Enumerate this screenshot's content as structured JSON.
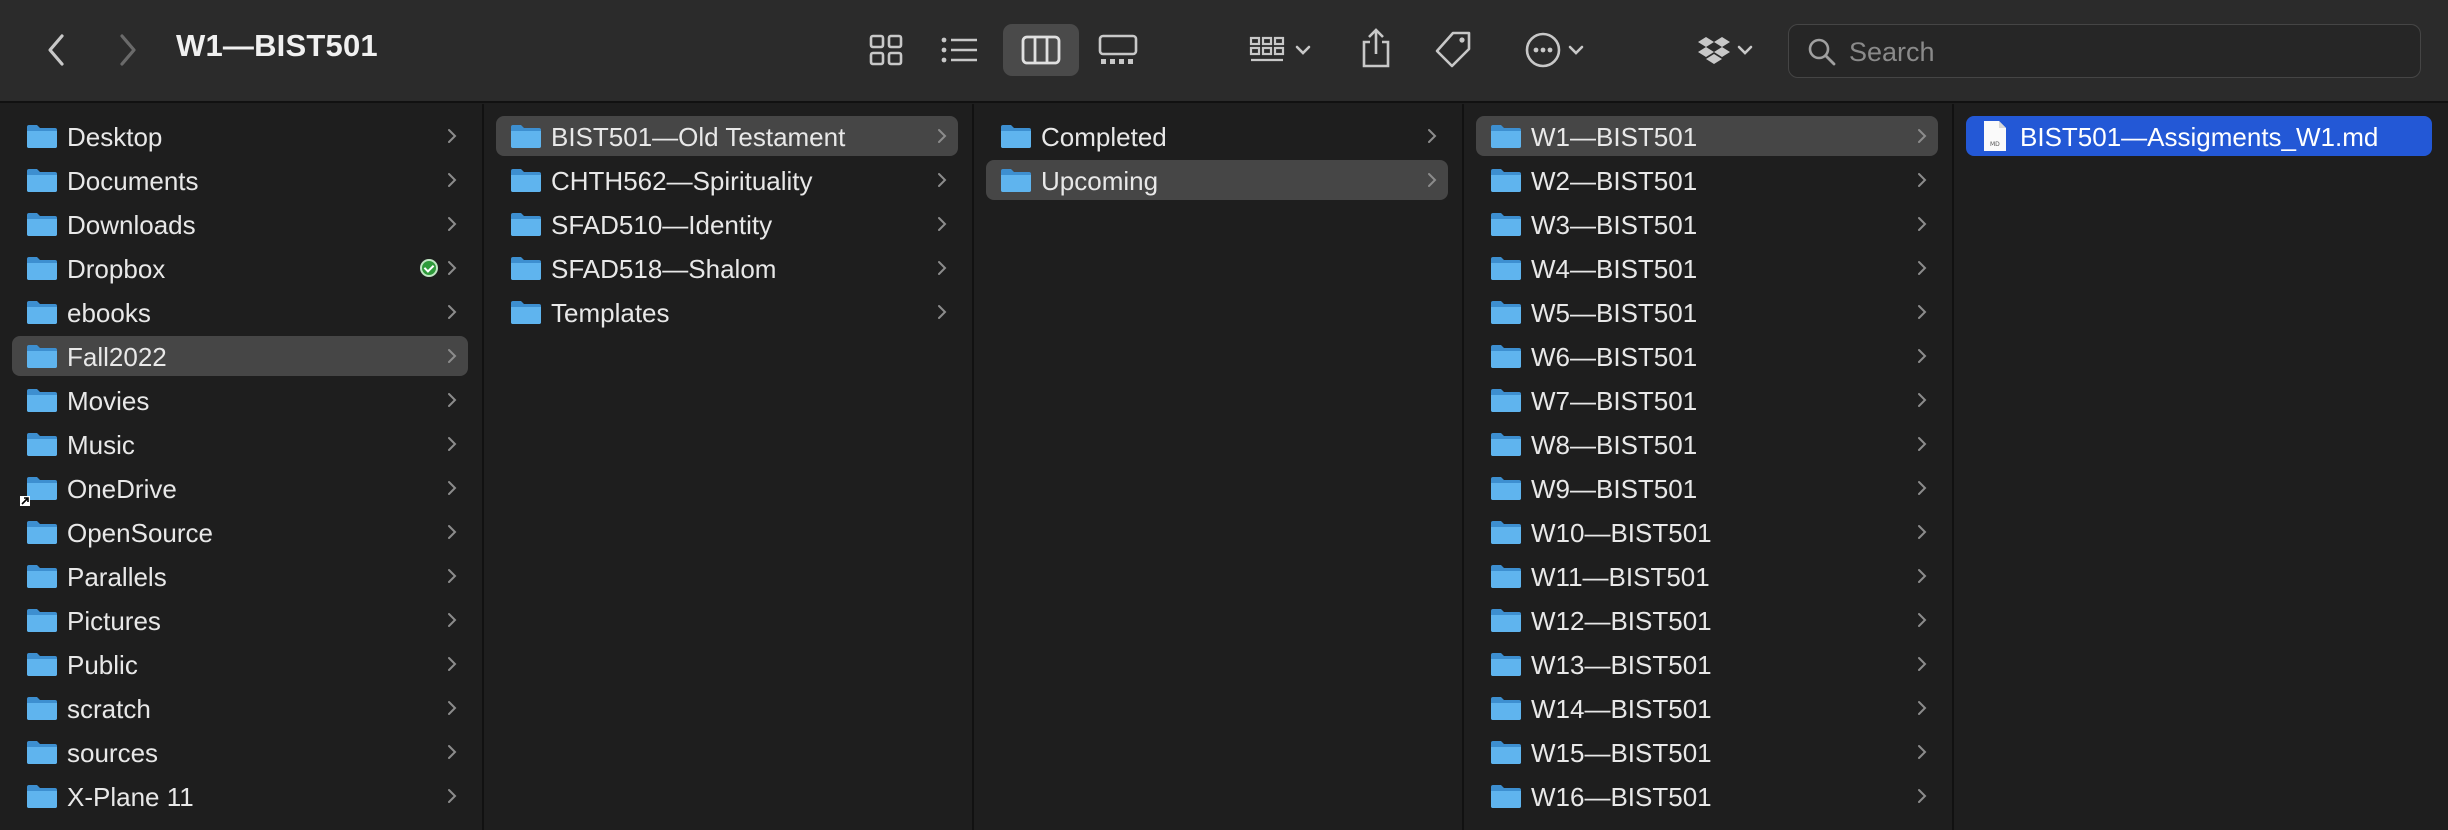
{
  "window": {
    "title": "W1—BIST501",
    "search_placeholder": "Search"
  },
  "toolbar": {
    "back_icon": "chevron-left-icon",
    "forward_icon": "chevron-right-icon",
    "views": [
      "icon-view-icon",
      "list-view-icon",
      "column-view-icon",
      "gallery-view-icon"
    ],
    "active_view": "column-view-icon",
    "actions": [
      "group-by-icon",
      "share-icon",
      "tag-icon",
      "more-icon",
      "dropbox-icon"
    ]
  },
  "columns": [
    {
      "items": [
        {
          "label": "Desktop",
          "icon": "desktop-folder-icon"
        },
        {
          "label": "Documents",
          "icon": "documents-folder-icon"
        },
        {
          "label": "Downloads",
          "icon": "downloads-folder-icon"
        },
        {
          "label": "Dropbox",
          "icon": "dropbox-folder-icon",
          "synced": true
        },
        {
          "label": "ebooks",
          "icon": "folder-icon"
        },
        {
          "label": "Fall2022",
          "icon": "folder-icon",
          "selected": true
        },
        {
          "label": "Movies",
          "icon": "movies-folder-icon"
        },
        {
          "label": "Music",
          "icon": "music-folder-icon"
        },
        {
          "label": "OneDrive",
          "icon": "alias-folder-icon"
        },
        {
          "label": "OpenSource",
          "icon": "folder-icon"
        },
        {
          "label": "Parallels",
          "icon": "folder-icon"
        },
        {
          "label": "Pictures",
          "icon": "pictures-folder-icon"
        },
        {
          "label": "Public",
          "icon": "public-folder-icon"
        },
        {
          "label": "scratch",
          "icon": "folder-icon"
        },
        {
          "label": "sources",
          "icon": "folder-icon"
        },
        {
          "label": "X-Plane 11",
          "icon": "folder-icon"
        }
      ]
    },
    {
      "items": [
        {
          "label": "BIST501—Old Testament",
          "icon": "folder-icon",
          "selected": true
        },
        {
          "label": "CHTH562—Spirituality",
          "icon": "folder-icon"
        },
        {
          "label": "SFAD510—Identity",
          "icon": "folder-icon"
        },
        {
          "label": "SFAD518—Shalom",
          "icon": "folder-icon"
        },
        {
          "label": "Templates",
          "icon": "folder-icon"
        }
      ]
    },
    {
      "items": [
        {
          "label": "Completed",
          "icon": "folder-icon"
        },
        {
          "label": "Upcoming",
          "icon": "folder-icon",
          "selected": true
        }
      ]
    },
    {
      "items": [
        {
          "label": "W1—BIST501",
          "icon": "folder-icon",
          "selected": true
        },
        {
          "label": "W2—BIST501",
          "icon": "folder-icon"
        },
        {
          "label": "W3—BIST501",
          "icon": "folder-icon"
        },
        {
          "label": "W4—BIST501",
          "icon": "folder-icon"
        },
        {
          "label": "W5—BIST501",
          "icon": "folder-icon"
        },
        {
          "label": "W6—BIST501",
          "icon": "folder-icon"
        },
        {
          "label": "W7—BIST501",
          "icon": "folder-icon"
        },
        {
          "label": "W8—BIST501",
          "icon": "folder-icon"
        },
        {
          "label": "W9—BIST501",
          "icon": "folder-icon"
        },
        {
          "label": "W10—BIST501",
          "icon": "folder-icon"
        },
        {
          "label": "W11—BIST501",
          "icon": "folder-icon"
        },
        {
          "label": "W12—BIST501",
          "icon": "folder-icon"
        },
        {
          "label": "W13—BIST501",
          "icon": "folder-icon"
        },
        {
          "label": "W14—BIST501",
          "icon": "folder-icon"
        },
        {
          "label": "W15—BIST501",
          "icon": "folder-icon"
        },
        {
          "label": "W16—BIST501",
          "icon": "folder-icon"
        }
      ]
    },
    {
      "items": [
        {
          "label": "BIST501—Assigments_W1.md",
          "icon": "markdown-file-icon",
          "selected": true,
          "is_file": true
        }
      ]
    }
  ],
  "colors": {
    "selection_gray": "#464646",
    "selection_blue": "#2358d6",
    "folder_blue": "#5fb4ee"
  }
}
